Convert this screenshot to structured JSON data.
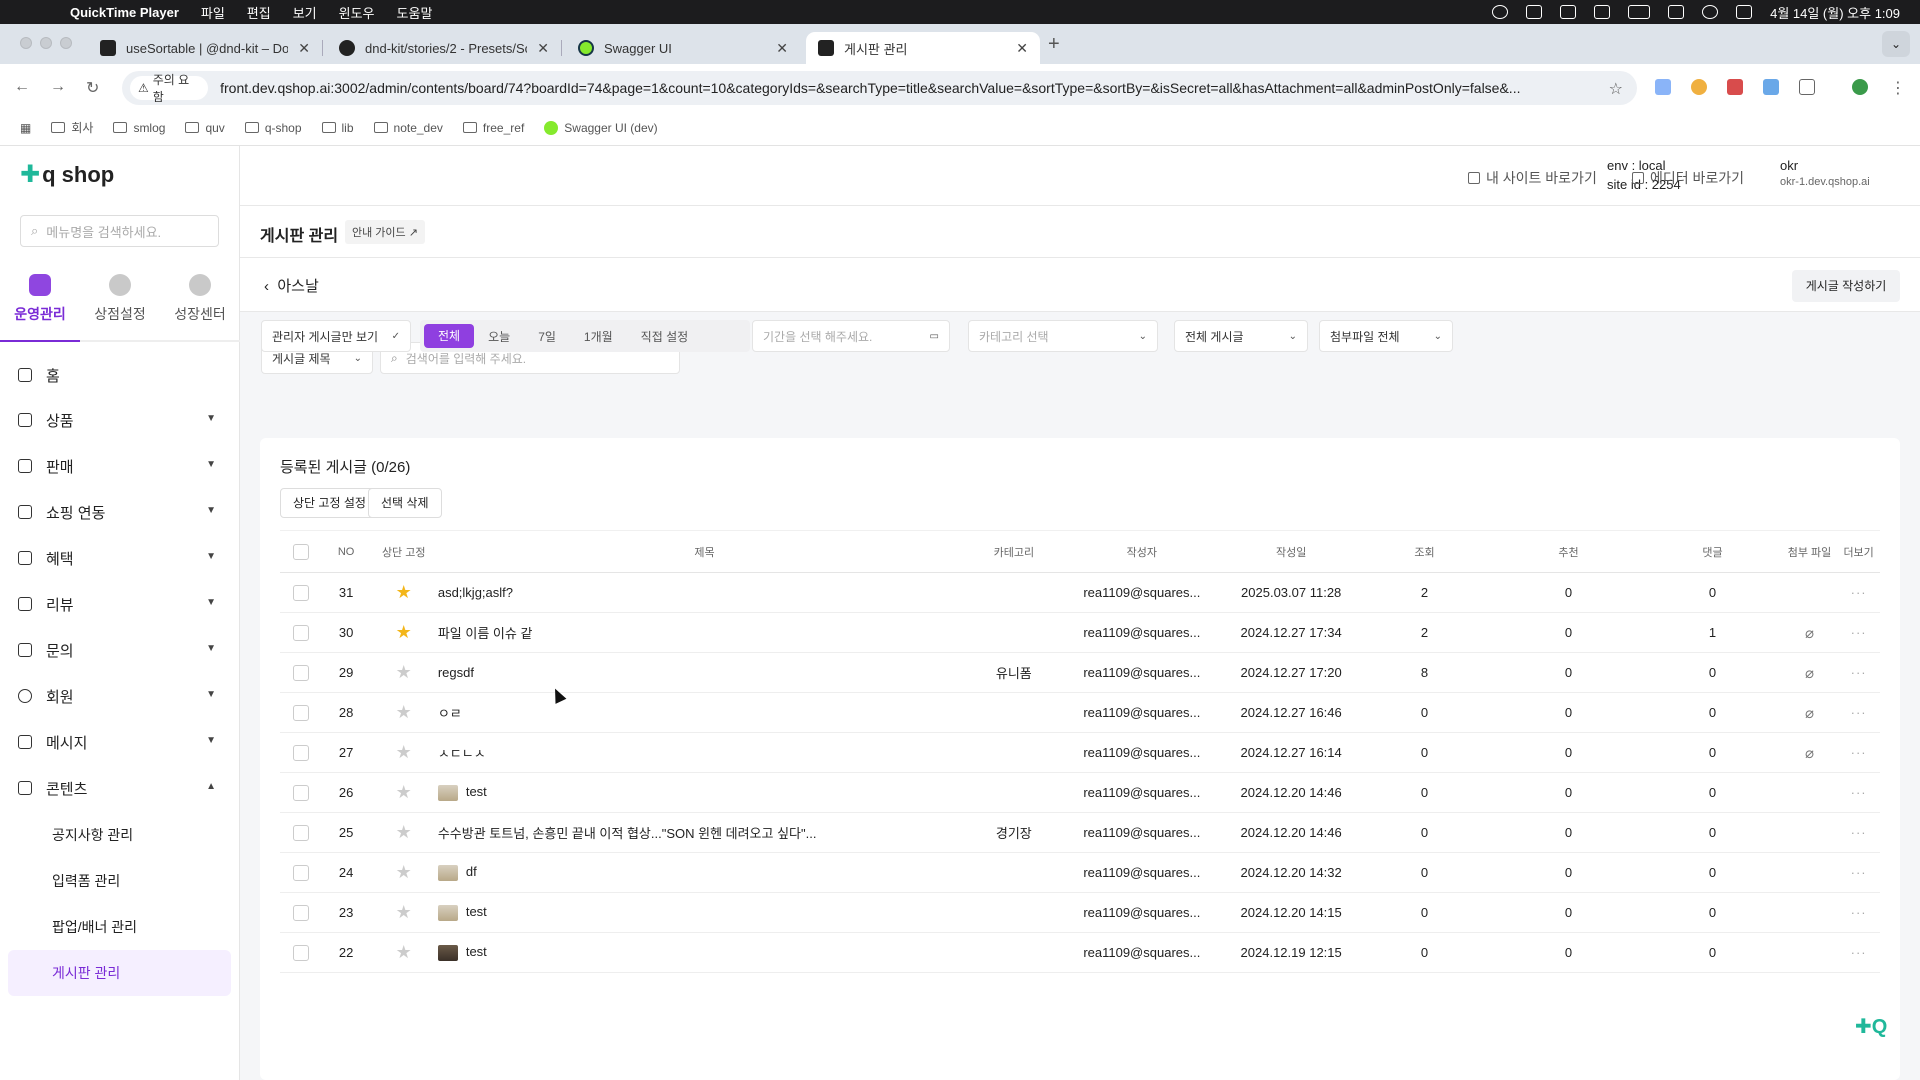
{
  "menubar": {
    "app": "QuickTime Player",
    "items": [
      "파일",
      "편집",
      "보기",
      "윈도우",
      "도움말"
    ],
    "clock": "4월 14일 (월) 오후 1:09"
  },
  "tabs": [
    {
      "title": "useSortable | @dnd-kit – Doc",
      "fav": "dndkit-icon"
    },
    {
      "title": "dnd-kit/stories/2 - Presets/Sc",
      "fav": "github-icon"
    },
    {
      "title": "Swagger UI",
      "fav": "swagger-icon"
    },
    {
      "title": "게시판 관리",
      "fav": "qshop-icon",
      "active": true
    }
  ],
  "address": {
    "warning": "주의 요함",
    "url": "front.dev.qshop.ai:3002/admin/contents/board/74?boardId=74&page=1&count=10&categoryIds=&searchType=title&searchValue=&sortType=&sortBy=&isSecret=all&hasAttachment=all&adminPostOnly=false&..."
  },
  "bookmarks": [
    "회사",
    "smlog",
    "quv",
    "q-shop",
    "lib",
    "note_dev",
    "free_ref",
    "Swagger UI (dev)"
  ],
  "sidebar": {
    "logo": "q shop",
    "search_placeholder": "메뉴명을 검색하세요.",
    "topnav": [
      "운영관리",
      "상점설정",
      "성장센터"
    ],
    "menu": [
      "홈",
      "상품",
      "판매",
      "쇼핑 연동",
      "혜택",
      "리뷰",
      "문의",
      "회원",
      "메시지",
      "콘텐츠"
    ],
    "submenu": [
      "공지사항 관리",
      "입력폼 관리",
      "팝업/배너 관리",
      "게시판 관리"
    ]
  },
  "header": {
    "env_label": "env : local",
    "site_label": "site id : 2254",
    "mysite": "내 사이트 바로가기",
    "editor": "에디터 바로가기",
    "user": "okr",
    "domain": "okr-1.dev.qshop.ai"
  },
  "page": {
    "title": "게시판 관리",
    "guide": "안내 가이드",
    "back": "아스날",
    "write": "게시글 작성하기"
  },
  "filters": {
    "search_type": "게시글 제목",
    "search_placeholder": "검색어를 입력해 주세요.",
    "admin_only": "관리자 게시글만 보기",
    "periods": [
      "전체",
      "오늘",
      "7일",
      "1개월",
      "직접 설정"
    ],
    "date_placeholder": "기간을 선택 해주세요.",
    "category_placeholder": "카테고리 선택",
    "post_type": "전체 게시글",
    "attachment": "첨부파일 전체"
  },
  "list": {
    "title": "등록된 게시글 (0/26)",
    "pin_btn": "상단 고정 설정",
    "delete_btn": "선택 삭제",
    "columns": [
      "NO",
      "상단 고정",
      "제목",
      "카테고리",
      "작성자",
      "작성일",
      "조회",
      "추천",
      "댓글",
      "첨부 파일",
      "더보기"
    ],
    "rows": [
      {
        "no": "31",
        "pinned": true,
        "title": "asd;lkjg;aslf?",
        "thumb": "",
        "category": "",
        "author": "rea1109@squares...",
        "date": "2025.03.07 11:28",
        "views": "2",
        "likes": "0",
        "comments": "0",
        "attach": false
      },
      {
        "no": "30",
        "pinned": true,
        "title": "파일 이름 이슈 같",
        "thumb": "",
        "category": "",
        "author": "rea1109@squares...",
        "date": "2024.12.27 17:34",
        "views": "2",
        "likes": "0",
        "comments": "1",
        "attach": true
      },
      {
        "no": "29",
        "pinned": false,
        "title": "regsdf",
        "thumb": "",
        "category": "유니폼",
        "author": "rea1109@squares...",
        "date": "2024.12.27 17:20",
        "views": "8",
        "likes": "0",
        "comments": "0",
        "attach": true
      },
      {
        "no": "28",
        "pinned": false,
        "title": "ㅇㄹ",
        "thumb": "",
        "category": "",
        "author": "rea1109@squares...",
        "date": "2024.12.27 16:46",
        "views": "0",
        "likes": "0",
        "comments": "0",
        "attach": true
      },
      {
        "no": "27",
        "pinned": false,
        "title": "ㅅㄷㄴㅅ",
        "thumb": "",
        "category": "",
        "author": "rea1109@squares...",
        "date": "2024.12.27 16:14",
        "views": "0",
        "likes": "0",
        "comments": "0",
        "attach": true
      },
      {
        "no": "26",
        "pinned": false,
        "title": "test",
        "thumb": "light",
        "category": "",
        "author": "rea1109@squares...",
        "date": "2024.12.20 14:46",
        "views": "0",
        "likes": "0",
        "comments": "0",
        "attach": false
      },
      {
        "no": "25",
        "pinned": false,
        "title": "수수방관 토트넘, 손흥민 끝내 이적 협상...\"SON 윈헨 데려오고 싶다\"...",
        "thumb": "",
        "category": "경기장",
        "author": "rea1109@squares...",
        "date": "2024.12.20 14:46",
        "views": "0",
        "likes": "0",
        "comments": "0",
        "attach": false
      },
      {
        "no": "24",
        "pinned": false,
        "title": "df",
        "thumb": "light",
        "category": "",
        "author": "rea1109@squares...",
        "date": "2024.12.20 14:32",
        "views": "0",
        "likes": "0",
        "comments": "0",
        "attach": false
      },
      {
        "no": "23",
        "pinned": false,
        "title": "test",
        "thumb": "light",
        "category": "",
        "author": "rea1109@squares...",
        "date": "2024.12.20 14:15",
        "views": "0",
        "likes": "0",
        "comments": "0",
        "attach": false
      },
      {
        "no": "22",
        "pinned": false,
        "title": "test",
        "thumb": "dark",
        "category": "",
        "author": "rea1109@squares...",
        "date": "2024.12.19 12:15",
        "views": "0",
        "likes": "0",
        "comments": "0",
        "attach": false
      }
    ]
  },
  "colors": {
    "accent": "#8f3fe0",
    "star": "#f3b61a",
    "brand": "#1fb89a"
  }
}
